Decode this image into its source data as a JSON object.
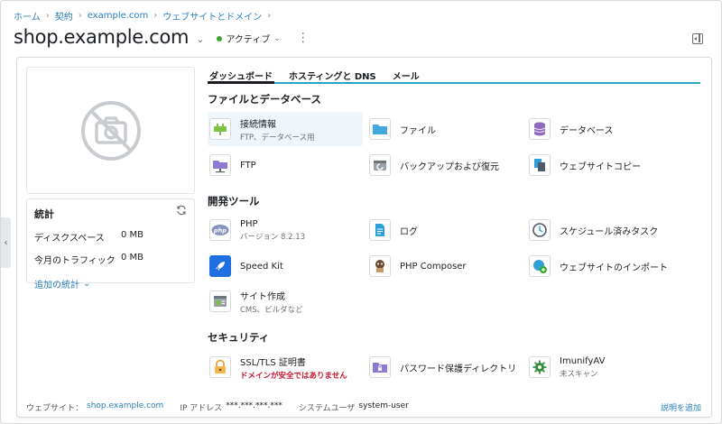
{
  "breadcrumb": [
    "ホーム",
    "契約",
    "example.com",
    "ウェブサイトとドメイン"
  ],
  "header": {
    "title": "shop.example.com",
    "status": "アクティブ",
    "status_color": "#36a82f"
  },
  "stats": {
    "title": "統計",
    "rows": [
      {
        "label": "ディスクスペース",
        "value": "0 MB"
      },
      {
        "label": "今月のトラフィック",
        "value": "0 MB"
      }
    ],
    "more_link": "追加の統計"
  },
  "tabs": [
    "ダッシュボード",
    "ホスティングと DNS",
    "メール"
  ],
  "sections": {
    "files": {
      "title": "ファイルとデータベース",
      "items": [
        {
          "label": "接続情報",
          "sub": "FTP、データベース用",
          "icon": "plug-icon"
        },
        {
          "label": "ファイル",
          "icon": "folder-icon"
        },
        {
          "label": "データベース",
          "icon": "database-icon"
        },
        {
          "label": "FTP",
          "icon": "ftp-folder-icon"
        },
        {
          "label": "バックアップおよび復元",
          "icon": "backup-icon"
        },
        {
          "label": "ウェブサイトコピー",
          "icon": "copy-icon"
        }
      ]
    },
    "dev": {
      "title": "開発ツール",
      "items": [
        {
          "label": "PHP",
          "sub": "バージョン 8.2.13",
          "icon": "php-icon"
        },
        {
          "label": "ログ",
          "icon": "log-icon"
        },
        {
          "label": "スケジュール済みタスク",
          "icon": "clock-icon"
        },
        {
          "label": "Speed Kit",
          "icon": "rocket-icon"
        },
        {
          "label": "PHP Composer",
          "icon": "composer-icon"
        },
        {
          "label": "ウェブサイトのインポート",
          "icon": "import-icon"
        },
        {
          "label": "サイト作成",
          "sub": "CMS、ビルダなど",
          "icon": "site-builder-icon"
        }
      ]
    },
    "security": {
      "title": "セキュリティ",
      "items": [
        {
          "label": "SSL/TLS 証明書",
          "sub": "ドメインが安全ではありません",
          "icon": "lock-icon"
        },
        {
          "label": "パスワード保護ディレクトリ",
          "icon": "protected-folder-icon"
        },
        {
          "label": "ImunifyAV",
          "sub": "未スキャン",
          "icon": "imunify-icon"
        }
      ]
    }
  },
  "footer": {
    "website_label": "ウェブサイト：",
    "website_value": "shop.example.com",
    "ip_label": "IP アドレス",
    "ip_value": "***.***.***.***",
    "user_label": "システムユーザ",
    "user_value": "system-user",
    "add_description": "説明を追加"
  }
}
